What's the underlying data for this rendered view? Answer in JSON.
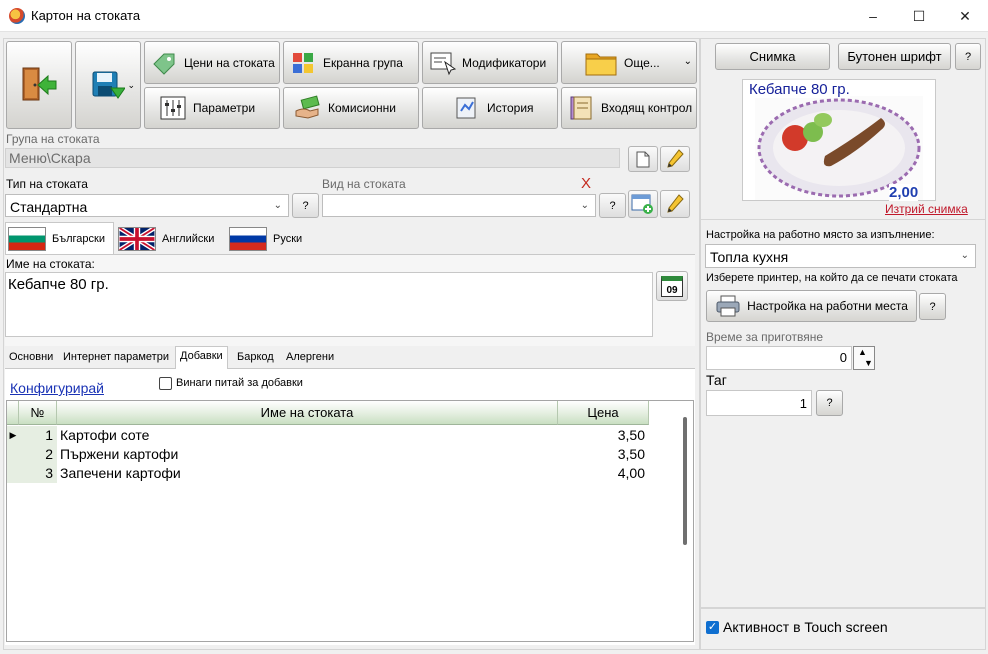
{
  "window": {
    "title": "Картон на стоката"
  },
  "toolbar": {
    "prices_label": "Цени на стоката",
    "screen_group_label": "Екранна група",
    "modifiers_label": "Модификатори",
    "more_label": "Още...",
    "parameters_label": "Параметри",
    "commissions_label": "Комисионни",
    "history_label": "История",
    "incoming_control_label": "Входящ контрол"
  },
  "group": {
    "label": "Група на стоката",
    "value": "Меню\\Скара"
  },
  "type": {
    "label": "Тип на стоката",
    "value": "Стандартна",
    "help": "?"
  },
  "kind": {
    "label": "Вид на стоката",
    "value": "",
    "clear_mark": "X",
    "help": "?"
  },
  "languages": [
    "Български",
    "Английски",
    "Руски"
  ],
  "name": {
    "label": "Име на стоката:",
    "value": "Кебапче 80 гр.",
    "calendar_day": "09"
  },
  "subtabs": [
    "Основни",
    "Интернет параметри",
    "Добавки",
    "Баркод",
    "Алергени"
  ],
  "addons": {
    "configure_link": "Конфигурирай",
    "always_ask_label": "Винаги питай за добавки",
    "columns": [
      "№",
      "Име на стоката",
      "Цена"
    ],
    "rows": [
      {
        "num": "1",
        "name": "Картофи соте",
        "price": "3,50"
      },
      {
        "num": "2",
        "name": "Пържени картофи",
        "price": "3,50"
      },
      {
        "num": "3",
        "name": "Запечени картофи",
        "price": "4,00"
      }
    ]
  },
  "right": {
    "photo_button": "Снимка",
    "button_font": "Бутонен шрифт",
    "help": "?",
    "preview_title": "Кебапче 80 гр.",
    "preview_price": "2,00",
    "delete_photo": "Изтрий снимка",
    "workplace_label": "Настройка на работно място за изпълнение:",
    "workplace_value": "Топла кухня",
    "printer_hint": "Изберете принтер, на който да се печати стоката",
    "workplace_button": "Настройка на работни места",
    "prep_time_label": "Време за приготвяне",
    "prep_time_value": "0",
    "tag_label": "Таг",
    "tag_value": "1",
    "touch_label": "Активност в Touch screen"
  },
  "colors": {
    "accent_blue": "#0f6fd0",
    "grid_header_green": "#c9dfc2",
    "price_blue": "#1f3fb0",
    "link_red": "#c0182a"
  }
}
